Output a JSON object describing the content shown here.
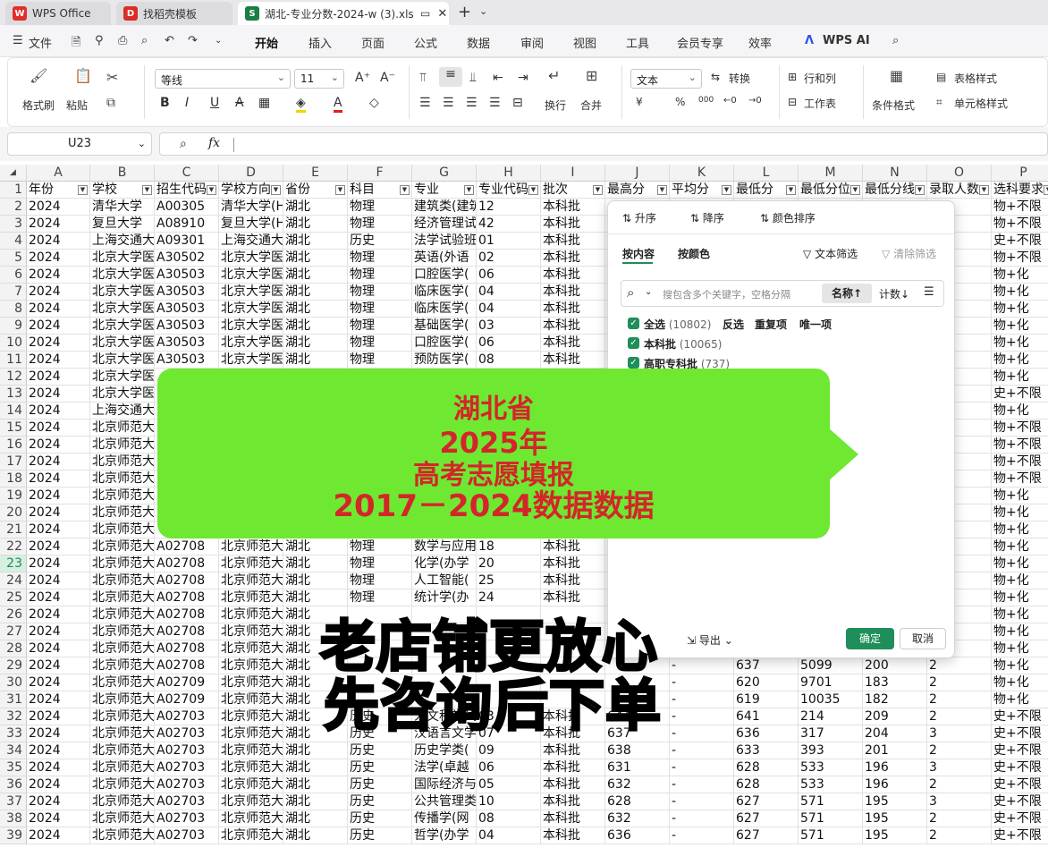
{
  "tabs": [
    {
      "label": "WPS Office",
      "icon": "wps-logo"
    },
    {
      "label": "找稻壳模板",
      "icon": "docer-logo"
    },
    {
      "label": "湖北-专业分数-2024-w (3).xls",
      "icon": "spreadsheet-s"
    }
  ],
  "menubar": {
    "file": "文件",
    "items": [
      "开始",
      "插入",
      "页面",
      "公式",
      "数据",
      "审阅",
      "视图",
      "工具",
      "会员专享",
      "效率"
    ],
    "ai": "WPS AI",
    "active": "开始"
  },
  "ribbon": {
    "format_painter": "格式刷",
    "paste": "粘贴",
    "font_name": "等线",
    "font_size": "11",
    "wrap": "换行",
    "merge": "合并",
    "number_format": "文本",
    "convert": "转换",
    "rows_cols": "行和列",
    "worksheet": "工作表",
    "cond_format": "条件格式",
    "table_style": "表格样式",
    "cell_style": "单元格样式",
    "percent": "%",
    "thousands": "000",
    "yen": "¥"
  },
  "formula_bar": {
    "cell_ref": "U23",
    "fx": "fx",
    "value": ""
  },
  "grid": {
    "columns": [
      "A",
      "B",
      "C",
      "D",
      "E",
      "F",
      "G",
      "H",
      "I",
      "J",
      "K",
      "L",
      "M",
      "N",
      "O",
      "P"
    ],
    "header_row": [
      "年份",
      "学校",
      "招生代码",
      "学校方向",
      "省份",
      "科目",
      "专业",
      "专业代码",
      "批次",
      "最高分",
      "平均分",
      "最低分",
      "最低分位",
      "最低分线",
      "录取人数",
      "选科要求"
    ],
    "rows": [
      [
        "2",
        "2024",
        "清华大学",
        "A00305",
        "清华大学(H",
        "湖北",
        "物理",
        "建筑类(建筑",
        "12",
        "本科批",
        "",
        "",
        "",
        "",
        "",
        "",
        "物+不限"
      ],
      [
        "3",
        "2024",
        "复旦大学",
        "A08910",
        "复旦大学(H",
        "湖北",
        "物理",
        "经济管理试",
        "42",
        "本科批",
        "",
        "",
        "",
        "",
        "",
        "",
        "物+不限"
      ],
      [
        "4",
        "2024",
        "上海交通大",
        "A09301",
        "上海交通大",
        "湖北",
        "历史",
        "法学试验班",
        "01",
        "本科批",
        "",
        "",
        "",
        "",
        "",
        "",
        "史+不限"
      ],
      [
        "5",
        "2024",
        "北京大学医",
        "A30502",
        "北京大学医",
        "湖北",
        "物理",
        "英语(外语",
        "02",
        "本科批",
        "",
        "",
        "",
        "",
        "",
        "",
        "物+不限"
      ],
      [
        "6",
        "2024",
        "北京大学医",
        "A30503",
        "北京大学医",
        "湖北",
        "物理",
        "口腔医学(",
        "06",
        "本科批",
        "",
        "",
        "",
        "",
        "",
        "",
        "物+化"
      ],
      [
        "7",
        "2024",
        "北京大学医",
        "A30503",
        "北京大学医",
        "湖北",
        "物理",
        "临床医学(",
        "04",
        "本科批",
        "",
        "",
        "",
        "",
        "",
        "",
        "物+化"
      ],
      [
        "8",
        "2024",
        "北京大学医",
        "A30503",
        "北京大学医",
        "湖北",
        "物理",
        "临床医学(",
        "04",
        "本科批",
        "",
        "",
        "",
        "",
        "",
        "",
        "物+化"
      ],
      [
        "9",
        "2024",
        "北京大学医",
        "A30503",
        "北京大学医",
        "湖北",
        "物理",
        "基础医学(",
        "03",
        "本科批",
        "",
        "",
        "",
        "",
        "",
        "",
        "物+化"
      ],
      [
        "10",
        "2024",
        "北京大学医",
        "A30503",
        "北京大学医",
        "湖北",
        "物理",
        "口腔医学(",
        "06",
        "本科批",
        "",
        "",
        "",
        "",
        "",
        "",
        "物+化"
      ],
      [
        "11",
        "2024",
        "北京大学医",
        "A30503",
        "北京大学医",
        "湖北",
        "物理",
        "预防医学(",
        "08",
        "本科批",
        "",
        "",
        "",
        "",
        "",
        "",
        "物+化"
      ],
      [
        "12",
        "2024",
        "北京大学医",
        "",
        "",
        "",
        "",
        "",
        "",
        "",
        "",
        "",
        "",
        "",
        "",
        "",
        "物+化"
      ],
      [
        "13",
        "2024",
        "北京大学医",
        "",
        "",
        "",
        "",
        "",
        "",
        "",
        "",
        "",
        "",
        "",
        "",
        "",
        "史+不限"
      ],
      [
        "14",
        "2024",
        "上海交通大",
        "",
        "",
        "",
        "",
        "",
        "",
        "",
        "",
        "",
        "",
        "",
        "",
        "",
        "物+化"
      ],
      [
        "15",
        "2024",
        "北京师范大",
        "",
        "",
        "",
        "",
        "",
        "",
        "",
        "",
        "",
        "",
        "",
        "",
        "",
        "物+不限"
      ],
      [
        "16",
        "2024",
        "北京师范大",
        "",
        "",
        "",
        "",
        "",
        "",
        "",
        "",
        "",
        "",
        "",
        "",
        "",
        "物+不限"
      ],
      [
        "17",
        "2024",
        "北京师范大",
        "",
        "",
        "",
        "",
        "",
        "",
        "",
        "",
        "",
        "",
        "",
        "",
        "",
        "物+不限"
      ],
      [
        "18",
        "2024",
        "北京师范大",
        "",
        "",
        "",
        "",
        "",
        "",
        "",
        "",
        "",
        "",
        "",
        "",
        "",
        "物+不限"
      ],
      [
        "19",
        "2024",
        "北京师范大",
        "",
        "",
        "",
        "",
        "",
        "",
        "",
        "",
        "",
        "",
        "",
        "",
        "",
        "物+化"
      ],
      [
        "20",
        "2024",
        "北京师范大",
        "",
        "",
        "",
        "",
        "",
        "",
        "",
        "",
        "",
        "",
        "",
        "",
        "",
        "物+化"
      ],
      [
        "21",
        "2024",
        "北京师范大",
        "",
        "",
        "",
        "",
        "",
        "",
        "",
        "",
        "",
        "",
        "",
        "",
        "",
        "物+化"
      ],
      [
        "22",
        "2024",
        "北京师范大",
        "A02708",
        "北京师范大",
        "湖北",
        "物理",
        "数学与应用",
        "18",
        "本科批",
        "",
        "",
        "",
        "",
        "",
        "",
        "物+化"
      ],
      [
        "23",
        "2024",
        "北京师范大",
        "A02708",
        "北京师范大",
        "湖北",
        "物理",
        "化学(办学",
        "20",
        "本科批",
        "",
        "",
        "",
        "",
        "",
        "",
        "物+化"
      ],
      [
        "24",
        "2024",
        "北京师范大",
        "A02708",
        "北京师范大",
        "湖北",
        "物理",
        "人工智能(",
        "25",
        "本科批",
        "",
        "",
        "",
        "",
        "",
        "",
        "物+化"
      ],
      [
        "25",
        "2024",
        "北京师范大",
        "A02708",
        "北京师范大",
        "湖北",
        "物理",
        "统计学(办",
        "24",
        "本科批",
        "",
        "",
        "",
        "",
        "",
        "",
        "物+化"
      ],
      [
        "26",
        "2024",
        "北京师范大",
        "A02708",
        "北京师范大",
        "湖北",
        "",
        "",
        "",
        "",
        "",
        "",
        "",
        "",
        "",
        "",
        "物+化"
      ],
      [
        "27",
        "2024",
        "北京师范大",
        "A02708",
        "北京师范大",
        "湖北",
        "",
        "",
        "",
        "",
        "",
        "",
        "",
        "",
        "",
        "",
        "物+化"
      ],
      [
        "28",
        "2024",
        "北京师范大",
        "A02708",
        "北京师范大",
        "湖北",
        "",
        "",
        "",
        "",
        "",
        "",
        "",
        "",
        "",
        "",
        "物+化"
      ],
      [
        "29",
        "2024",
        "北京师范大",
        "A02708",
        "北京师范大",
        "湖北",
        "",
        "",
        "",
        "",
        "",
        "-",
        "637",
        "5099",
        "200",
        "2",
        "物+化"
      ],
      [
        "30",
        "2024",
        "北京师范大",
        "A02709",
        "北京师范大",
        "湖北",
        "",
        "",
        "",
        "",
        "",
        "-",
        "620",
        "9701",
        "183",
        "2",
        "物+化"
      ],
      [
        "31",
        "2024",
        "北京师范大",
        "A02709",
        "北京师范大",
        "湖北",
        "",
        "",
        "",
        "",
        "",
        "-",
        "619",
        "10035",
        "182",
        "2",
        "物+化"
      ],
      [
        "32",
        "2024",
        "北京师范大",
        "A02703",
        "北京师范大",
        "湖北",
        "历史",
        "人文科学试",
        "03",
        "本科批",
        "644",
        "-",
        "641",
        "214",
        "209",
        "2",
        "史+不限"
      ],
      [
        "33",
        "2024",
        "北京师范大",
        "A02703",
        "北京师范大",
        "湖北",
        "历史",
        "汉语言文学",
        "07",
        "本科批",
        "637",
        "-",
        "636",
        "317",
        "204",
        "3",
        "史+不限"
      ],
      [
        "34",
        "2024",
        "北京师范大",
        "A02703",
        "北京师范大",
        "湖北",
        "历史",
        "历史学类(",
        "09",
        "本科批",
        "638",
        "-",
        "633",
        "393",
        "201",
        "2",
        "史+不限"
      ],
      [
        "35",
        "2024",
        "北京师范大",
        "A02703",
        "北京师范大",
        "湖北",
        "历史",
        "法学(卓越",
        "06",
        "本科批",
        "631",
        "-",
        "628",
        "533",
        "196",
        "3",
        "史+不限"
      ],
      [
        "36",
        "2024",
        "北京师范大",
        "A02703",
        "北京师范大",
        "湖北",
        "历史",
        "国际经济与",
        "05",
        "本科批",
        "632",
        "-",
        "628",
        "533",
        "196",
        "2",
        "史+不限"
      ],
      [
        "37",
        "2024",
        "北京师范大",
        "A02703",
        "北京师范大",
        "湖北",
        "历史",
        "公共管理类",
        "10",
        "本科批",
        "628",
        "-",
        "627",
        "571",
        "195",
        "3",
        "史+不限"
      ],
      [
        "38",
        "2024",
        "北京师范大",
        "A02703",
        "北京师范大",
        "湖北",
        "历史",
        "传播学(网",
        "08",
        "本科批",
        "632",
        "-",
        "627",
        "571",
        "195",
        "2",
        "史+不限"
      ],
      [
        "39",
        "2024",
        "北京师范大",
        "A02703",
        "北京师范大",
        "湖北",
        "历史",
        "哲学(办学",
        "04",
        "本科批",
        "636",
        "-",
        "627",
        "571",
        "195",
        "2",
        "史+不限"
      ]
    ]
  },
  "filter_panel": {
    "sort_asc": "升序",
    "sort_desc": "降序",
    "sort_color": "颜色排序",
    "tab_content": "按内容",
    "tab_color": "按颜色",
    "text_filter": "文本筛选",
    "clear_filter": "清除筛选",
    "search_placeholder": "搜包含多个关键字，空格分隔",
    "sort_name": "名称↑",
    "sort_count": "计数↓",
    "select_all": "全选",
    "select_all_count": "(10802)",
    "invert": "反选",
    "duplicates": "重复项",
    "unique": "唯一项",
    "items": [
      {
        "label": "本科批",
        "count": "(10065)"
      },
      {
        "label": "高职专科批",
        "count": "(737)"
      }
    ],
    "export": "导出",
    "ok": "确定",
    "cancel": "取消"
  },
  "promo": {
    "line1": "湖北省",
    "line2": "2025年",
    "line3": "高考志愿填报",
    "line4": "2017－2024数据数据",
    "slogan1": "老店铺更放心",
    "slogan2": "先咨询后下单"
  },
  "colors": {
    "accent_green": "#1e8e5a",
    "banner_green": "#6fe832",
    "promo_red": "#d9151b"
  }
}
